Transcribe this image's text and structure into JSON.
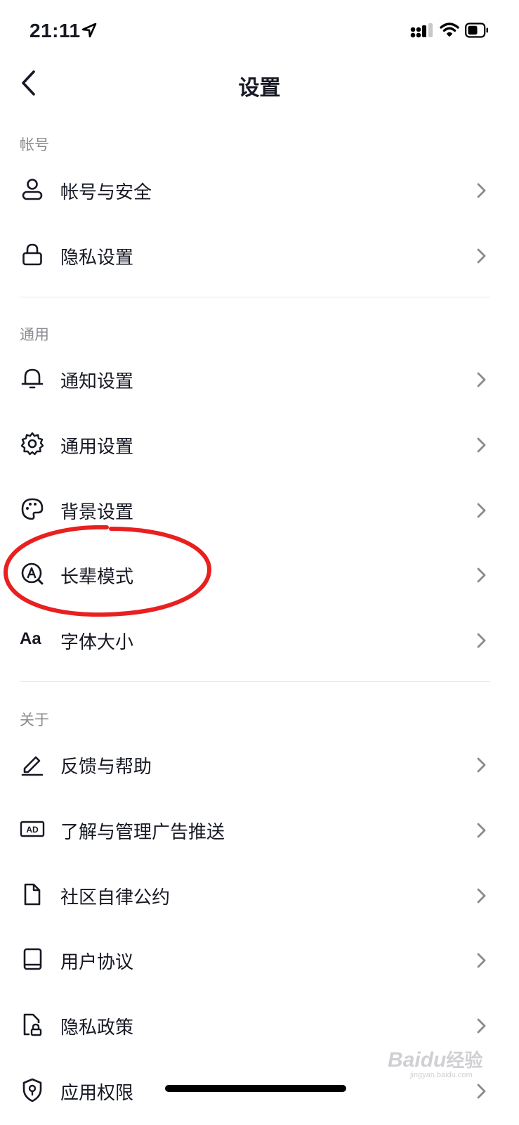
{
  "status": {
    "time": "21:11"
  },
  "header": {
    "title": "设置"
  },
  "sections": [
    {
      "title": "帐号",
      "items": [
        {
          "label": "帐号与安全"
        },
        {
          "label": "隐私设置"
        }
      ]
    },
    {
      "title": "通用",
      "items": [
        {
          "label": "通知设置"
        },
        {
          "label": "通用设置"
        },
        {
          "label": "背景设置"
        },
        {
          "label": "长辈模式"
        },
        {
          "label": "字体大小",
          "icon_text": "Aa"
        }
      ]
    },
    {
      "title": "关于",
      "items": [
        {
          "label": "反馈与帮助"
        },
        {
          "label": "了解与管理广告推送",
          "icon_text": "AD"
        },
        {
          "label": "社区自律公约"
        },
        {
          "label": "用户协议"
        },
        {
          "label": "隐私政策"
        },
        {
          "label": "应用权限"
        }
      ]
    }
  ],
  "watermark": {
    "main": "Bai",
    "mark": "du",
    "cn": "经验",
    "sub": "jingyan.baidu.com"
  },
  "colors": {
    "text": "#161823",
    "section": "#8a8b91",
    "chevron": "#8a8b91",
    "annotation": "#e8201f",
    "background": "#ffffff"
  }
}
